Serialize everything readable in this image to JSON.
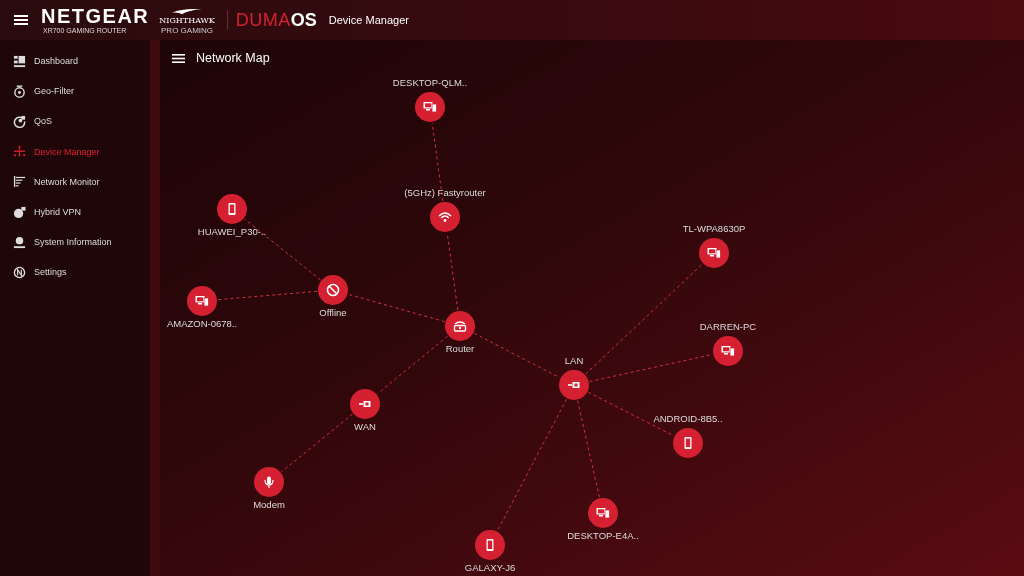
{
  "header": {
    "brand": "NETGEAR",
    "model": "XR700 GAMING ROUTER",
    "sub_brand": "NIGHTHAWK",
    "sub_brand_tag": "PRO GAMING",
    "os_light": "DUMA",
    "os_bold": "OS",
    "page": "Device Manager"
  },
  "sidebar": {
    "items": [
      {
        "label": "Dashboard",
        "selected": false
      },
      {
        "label": "Geo-Filter",
        "selected": false
      },
      {
        "label": "QoS",
        "selected": false
      },
      {
        "label": "Device Manager",
        "selected": true
      },
      {
        "label": "Network Monitor",
        "selected": false
      },
      {
        "label": "Hybrid VPN",
        "selected": false
      },
      {
        "label": "System Information",
        "selected": false
      },
      {
        "label": "Settings",
        "selected": false
      }
    ]
  },
  "network_map": {
    "title": "Network Map",
    "root": {
      "label": "Router",
      "kind": "router",
      "children": [
        {
          "label": "(5GHz) Fastyrouter",
          "kind": "wifi",
          "children": [
            {
              "label": "DESKTOP-QLM..",
              "kind": "desktop"
            }
          ]
        },
        {
          "label": "Offline",
          "kind": "offline",
          "children": [
            {
              "label": "HUAWEI_P30-..",
              "kind": "phone"
            },
            {
              "label": "AMAZON-0678..",
              "kind": "desktop"
            }
          ]
        },
        {
          "label": "WAN",
          "kind": "ethernet",
          "children": [
            {
              "label": "Modem",
              "kind": "modem"
            }
          ]
        },
        {
          "label": "LAN",
          "kind": "ethernet",
          "children": [
            {
              "label": "TL-WPA8630P",
              "kind": "desktop"
            },
            {
              "label": "DARREN-PC",
              "kind": "desktop"
            },
            {
              "label": "ANDROID-8B5..",
              "kind": "phone"
            },
            {
              "label": "DESKTOP-E4A..",
              "kind": "desktop"
            },
            {
              "label": "GALAXY-J6",
              "kind": "phone"
            }
          ]
        }
      ]
    }
  }
}
